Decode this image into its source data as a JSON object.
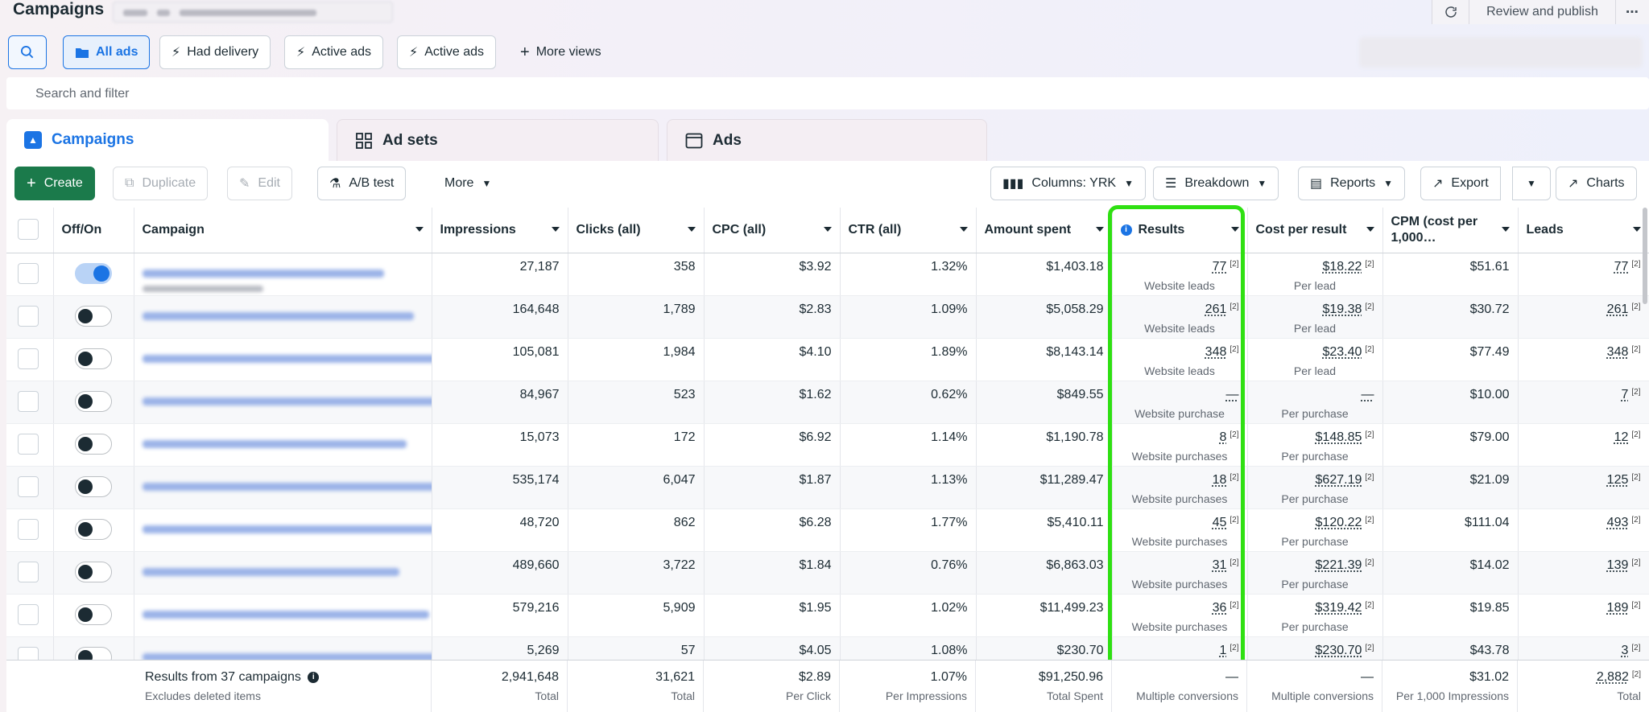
{
  "header": {
    "title": "Campaigns",
    "refresh_icon": "refresh-icon",
    "review_label": "Review and publish",
    "more_label": "⋯"
  },
  "views": {
    "all_ads": "All ads",
    "had_delivery": "Had delivery",
    "active_ads_1": "Active ads",
    "active_ads_2": "Active ads",
    "more_views": "More views"
  },
  "search": {
    "placeholder": "Search and filter"
  },
  "tabs": {
    "campaigns": "Campaigns",
    "ad_sets": "Ad sets",
    "ads": "Ads"
  },
  "toolbar": {
    "create": "Create",
    "duplicate": "Duplicate",
    "edit": "Edit",
    "ab_test": "A/B test",
    "more": "More",
    "columns": "Columns: YRK",
    "breakdown": "Breakdown",
    "reports": "Reports",
    "export": "Export",
    "charts": "Charts"
  },
  "columns": {
    "offon": "Off/On",
    "campaign": "Campaign",
    "impressions": "Impressions",
    "clicks": "Clicks (all)",
    "cpc": "CPC (all)",
    "ctr": "CTR (all)",
    "amount": "Amount spent",
    "results": "Results",
    "cpr": "Cost per result",
    "cpm": "CPM (cost per 1,000…",
    "leads": "Leads"
  },
  "rows": [
    {
      "on": true,
      "impressions": "27,187",
      "clicks": "358",
      "cpc": "$3.92",
      "ctr": "1.32%",
      "amount": "$1,403.18",
      "results": "77",
      "results_label": "Website leads",
      "cpr": "$18.22",
      "cpr_label": "Per lead",
      "cpm": "$51.61",
      "leads": "77"
    },
    {
      "on": false,
      "impressions": "164,648",
      "clicks": "1,789",
      "cpc": "$2.83",
      "ctr": "1.09%",
      "amount": "$5,058.29",
      "results": "261",
      "results_label": "Website leads",
      "cpr": "$19.38",
      "cpr_label": "Per lead",
      "cpm": "$30.72",
      "leads": "261"
    },
    {
      "on": false,
      "impressions": "105,081",
      "clicks": "1,984",
      "cpc": "$4.10",
      "ctr": "1.89%",
      "amount": "$8,143.14",
      "results": "348",
      "results_label": "Website leads",
      "cpr": "$23.40",
      "cpr_label": "Per lead",
      "cpm": "$77.49",
      "leads": "348"
    },
    {
      "on": false,
      "impressions": "84,967",
      "clicks": "523",
      "cpc": "$1.62",
      "ctr": "0.62%",
      "amount": "$849.55",
      "results": "—",
      "results_label": "Website purchase",
      "cpr": "—",
      "cpr_label": "Per purchase",
      "cpm": "$10.00",
      "leads": "7"
    },
    {
      "on": false,
      "impressions": "15,073",
      "clicks": "172",
      "cpc": "$6.92",
      "ctr": "1.14%",
      "amount": "$1,190.78",
      "results": "8",
      "results_label": "Website purchases",
      "cpr": "$148.85",
      "cpr_label": "Per purchase",
      "cpm": "$79.00",
      "leads": "12"
    },
    {
      "on": false,
      "impressions": "535,174",
      "clicks": "6,047",
      "cpc": "$1.87",
      "ctr": "1.13%",
      "amount": "$11,289.47",
      "results": "18",
      "results_label": "Website purchases",
      "cpr": "$627.19",
      "cpr_label": "Per purchase",
      "cpm": "$21.09",
      "leads": "125"
    },
    {
      "on": false,
      "impressions": "48,720",
      "clicks": "862",
      "cpc": "$6.28",
      "ctr": "1.77%",
      "amount": "$5,410.11",
      "results": "45",
      "results_label": "Website purchases",
      "cpr": "$120.22",
      "cpr_label": "Per purchase",
      "cpm": "$111.04",
      "leads": "493"
    },
    {
      "on": false,
      "impressions": "489,660",
      "clicks": "3,722",
      "cpc": "$1.84",
      "ctr": "0.76%",
      "amount": "$6,863.03",
      "results": "31",
      "results_label": "Website purchases",
      "cpr": "$221.39",
      "cpr_label": "Per purchase",
      "cpm": "$14.02",
      "leads": "139"
    },
    {
      "on": false,
      "impressions": "579,216",
      "clicks": "5,909",
      "cpc": "$1.95",
      "ctr": "1.02%",
      "amount": "$11,499.23",
      "results": "36",
      "results_label": "Website purchases",
      "cpr": "$319.42",
      "cpr_label": "Per purchase",
      "cpm": "$19.85",
      "leads": "189"
    },
    {
      "on": false,
      "impressions": "5,269",
      "clicks": "57",
      "cpc": "$4.05",
      "ctr": "1.08%",
      "amount": "$230.70",
      "results": "1",
      "results_label": "",
      "cpr": "$230.70",
      "cpr_label": "",
      "cpm": "$43.78",
      "leads": "3"
    }
  ],
  "footnote_marker": "[2]",
  "totals": {
    "label": "Results from 37 campaigns",
    "sublabel": "Excludes deleted items",
    "impressions": "2,941,648",
    "impressions_label": "Total",
    "clicks": "31,621",
    "clicks_label": "Total",
    "cpc": "$2.89",
    "cpc_label": "Per Click",
    "ctr": "1.07%",
    "ctr_label": "Per Impressions",
    "amount": "$91,250.96",
    "amount_label": "Total Spent",
    "results": "—",
    "results_label": "Multiple conversions",
    "cpr": "—",
    "cpr_label": "Multiple conversions",
    "cpm": "$31.02",
    "cpm_label": "Per 1,000 Impressions",
    "leads": "2,882",
    "leads_label": "Total"
  },
  "colors": {
    "accent": "#1b74e4",
    "create": "#1b7a4b",
    "highlight": "#2fe012"
  }
}
